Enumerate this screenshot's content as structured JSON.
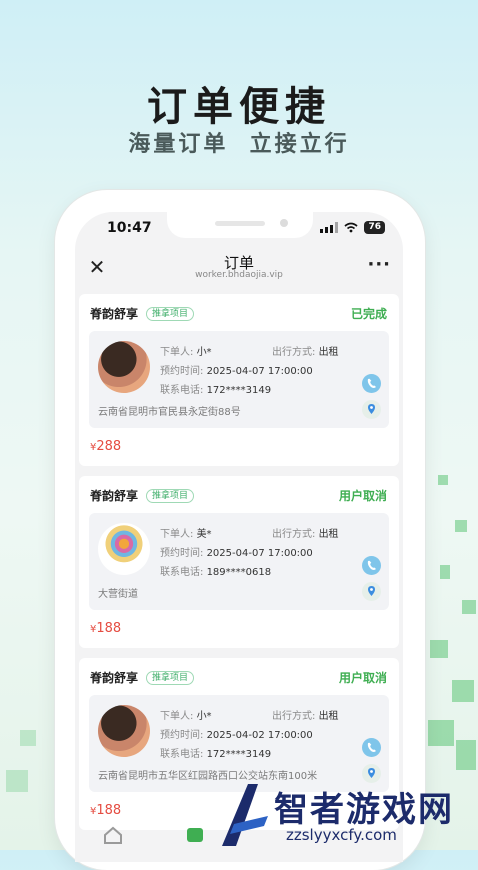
{
  "hero": {
    "title": "订单便捷",
    "subtitle": "海量订单  立接立行"
  },
  "status_bar": {
    "time": "10:47",
    "battery": "76"
  },
  "nav": {
    "title": "订单",
    "url": "worker.bhdaojia.vip"
  },
  "orders": [
    {
      "service": "脊韵舒享",
      "tag": "推拿项目",
      "status": "已完成",
      "orderer_label": "下单人:",
      "orderer": "小*",
      "travel_label": "出行方式:",
      "travel": "出租",
      "time_label": "预约时间:",
      "time": "2025-04-07 17:00:00",
      "phone_label": "联系电话:",
      "phone": "172****3149",
      "address": "云南省昆明市官民县永定街88号",
      "currency": "¥",
      "price": "288"
    },
    {
      "service": "脊韵舒享",
      "tag": "推拿项目",
      "status": "用户取消",
      "orderer_label": "下单人:",
      "orderer": "美*",
      "travel_label": "出行方式:",
      "travel": "出租",
      "time_label": "预约时间:",
      "time": "2025-04-07 17:00:00",
      "phone_label": "联系电话:",
      "phone": "189****0618",
      "address": "大营街道",
      "currency": "¥",
      "price": "188"
    },
    {
      "service": "脊韵舒享",
      "tag": "推拿项目",
      "status": "用户取消",
      "orderer_label": "下单人:",
      "orderer": "小*",
      "travel_label": "出行方式:",
      "travel": "出租",
      "time_label": "预约时间:",
      "time": "2025-04-02 17:00:00",
      "phone_label": "联系电话:",
      "phone": "172****3149",
      "address": "云南省昆明市五华区红园路西口公交站东南100米",
      "currency": "¥",
      "price": "188"
    }
  ],
  "watermark": {
    "name": "智者游戏网",
    "url": "zzslyyxcfy.com"
  },
  "colors": {
    "accent_green": "#3fae52",
    "price_red": "#e54d42",
    "phone_blue": "#7fc5ea"
  }
}
